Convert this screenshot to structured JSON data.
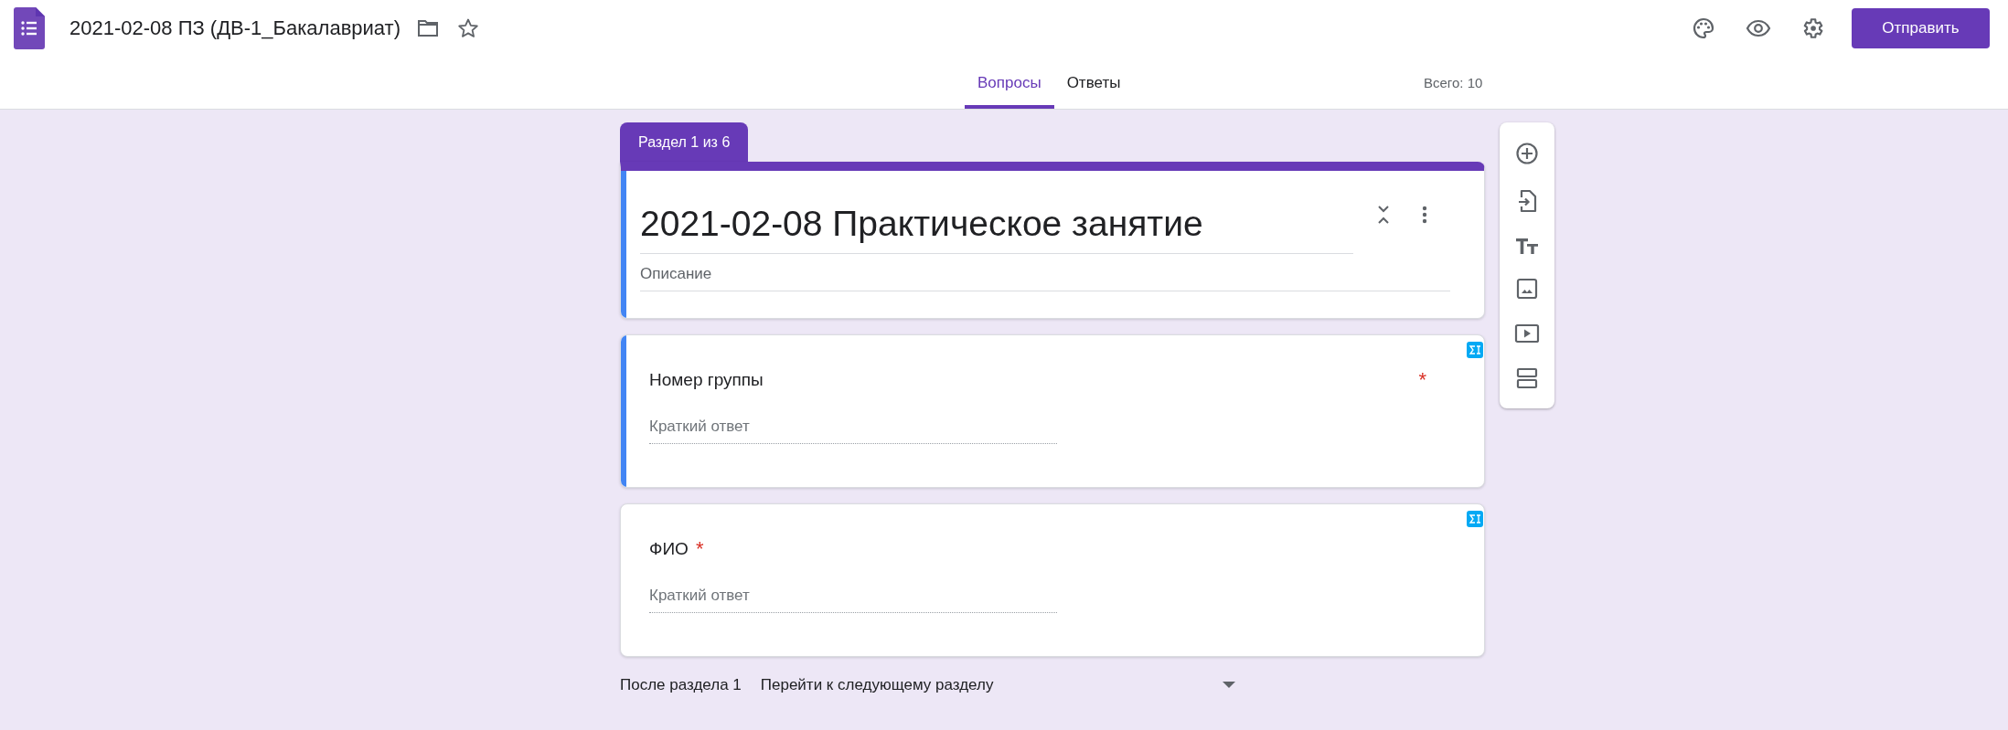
{
  "app": {
    "title": "2021-02-08 ПЗ (ДВ-1_Бакалавриат)",
    "send_button": "Отправить"
  },
  "tabs": [
    {
      "label": "Вопросы",
      "selected": true
    },
    {
      "label": "Ответы",
      "selected": false
    }
  ],
  "total": "Всего: 10",
  "section": {
    "badge": "Раздел 1 из 6",
    "title": "2021-02-08 Практическое занятие",
    "description": {
      "placeholder": "Описание"
    },
    "selected": true
  },
  "questions": [
    {
      "title": "Номер группы",
      "required_mark": "*",
      "placeholder": "Краткий ответ",
      "selected": true
    },
    {
      "title": "ФИО",
      "required_mark": "*",
      "placeholder": "Краткий ответ",
      "selected": false
    }
  ],
  "after_section": {
    "label": "После раздела 1",
    "value": "Перейти к следующему разделу"
  }
}
